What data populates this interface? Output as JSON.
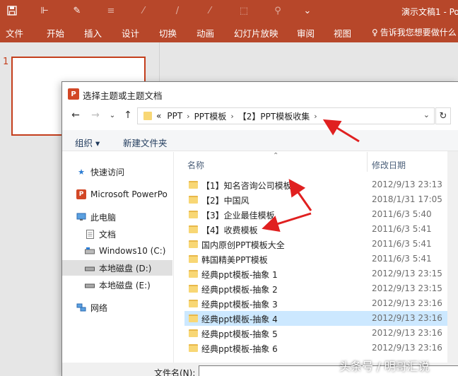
{
  "app": {
    "window_title": "演示文稿1 - Po",
    "ribbon_tabs": [
      "文件",
      "开始",
      "插入",
      "设计",
      "切换",
      "动画",
      "幻灯片放映",
      "审阅",
      "视图"
    ],
    "tell_me": "告诉我您想要做什么",
    "slide_number": "1",
    "accent": "#b7472a"
  },
  "dialog": {
    "title": "选择主题或主题文档",
    "icon_label": "P",
    "breadcrumb": [
      "PPT",
      "PPT模板",
      "【2】PPT模板收集"
    ],
    "breadcrumb_prefix": "«",
    "toolbar": {
      "organize": "组织 ▾",
      "new_folder": "新建文件夹"
    },
    "columns": {
      "name": "名称",
      "date": "修改日期"
    },
    "nav": [
      {
        "label": "快速访问",
        "icon": "star-icon"
      },
      {
        "label": "Microsoft PowerPo",
        "icon": "powerpoint-icon"
      },
      {
        "label": "此电脑",
        "icon": "computer-icon"
      },
      {
        "label": "文档",
        "icon": "document-icon"
      },
      {
        "label": "Windows10 (C:)",
        "icon": "drive-icon"
      },
      {
        "label": "本地磁盘 (D:)",
        "icon": "drive-icon"
      },
      {
        "label": "本地磁盘 (E:)",
        "icon": "drive-icon"
      },
      {
        "label": "网络",
        "icon": "network-icon"
      }
    ],
    "files": [
      {
        "name": "【1】知名咨询公司模板",
        "date": "2012/9/13 23:13"
      },
      {
        "name": "【2】中国风",
        "date": "2018/1/31 17:05"
      },
      {
        "name": "【3】企业最佳模板",
        "date": "2011/6/3 5:40"
      },
      {
        "name": "【4】收费模板",
        "date": "2011/6/3 5:41"
      },
      {
        "name": "国内原创PPT模板大全",
        "date": "2011/6/3 5:41"
      },
      {
        "name": "韩国精美PPT模板",
        "date": "2011/6/3 5:41"
      },
      {
        "name": "经典ppt模板-抽象 1",
        "date": "2012/9/13 23:15"
      },
      {
        "name": "经典ppt模板-抽象 2",
        "date": "2012/9/13 23:15"
      },
      {
        "name": "经典ppt模板-抽象 3",
        "date": "2012/9/13 23:16"
      },
      {
        "name": "经典ppt模板-抽象 4",
        "date": "2012/9/13 23:16"
      },
      {
        "name": "经典ppt模板-抽象 5",
        "date": "2012/9/13 23:16"
      },
      {
        "name": "经典ppt模板-抽象 6",
        "date": "2012/9/13 23:16"
      }
    ],
    "selected_index": 9,
    "filename_label": "文件名(N):"
  },
  "watermark": "头条号 / 明哥汇说"
}
